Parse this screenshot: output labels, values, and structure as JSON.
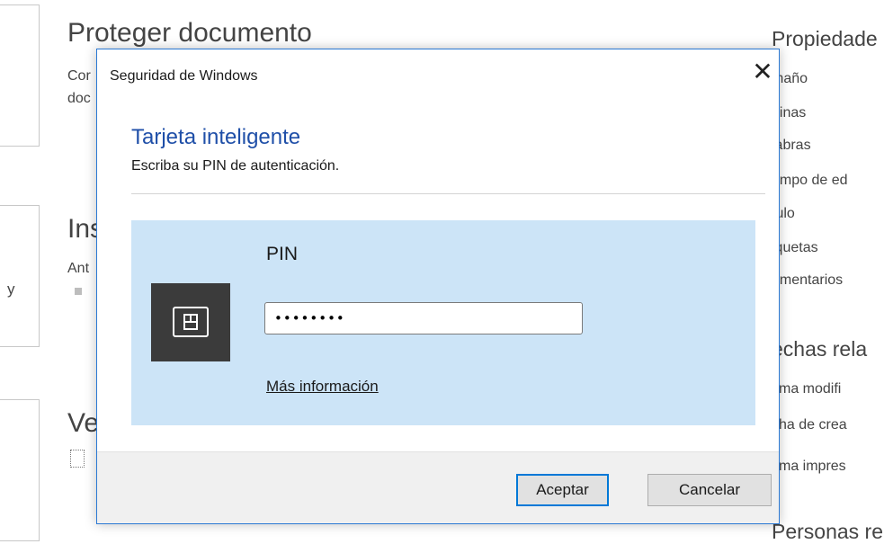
{
  "background": {
    "tile_text": "y",
    "sections": [
      {
        "title": "Proteger documento",
        "lines": [
          "Cor",
          "doc"
        ]
      },
      {
        "title": "Ins",
        "lines": [
          "Ant"
        ]
      },
      {
        "title": "Ve"
      }
    ],
    "properties": {
      "heading": "Propiedade",
      "items": [
        "maño",
        "ginas",
        "labras",
        "empo de ed",
        "tulo",
        "iquetas",
        "omentarios"
      ],
      "dates_heading": "echas rela",
      "dates": [
        "tima modifi",
        "cha de crea",
        "tima impres"
      ],
      "people_heading": "Personas re"
    }
  },
  "dialog": {
    "title": "Seguridad de Windows",
    "close_glyph": "✕",
    "heading": "Tarjeta inteligente",
    "subtitle": "Escriba su PIN de autenticación.",
    "pin_label": "PIN",
    "pin_value": "••••••••",
    "more_info": "Más información",
    "ok_button": "Aceptar",
    "cancel_button": "Cancelar",
    "icon": "smart-card-icon"
  },
  "colors": {
    "accent": "#2b79d4",
    "heading": "#1f4fa8",
    "panel": "#cce4f7",
    "icon_box": "#3b3b3b"
  }
}
